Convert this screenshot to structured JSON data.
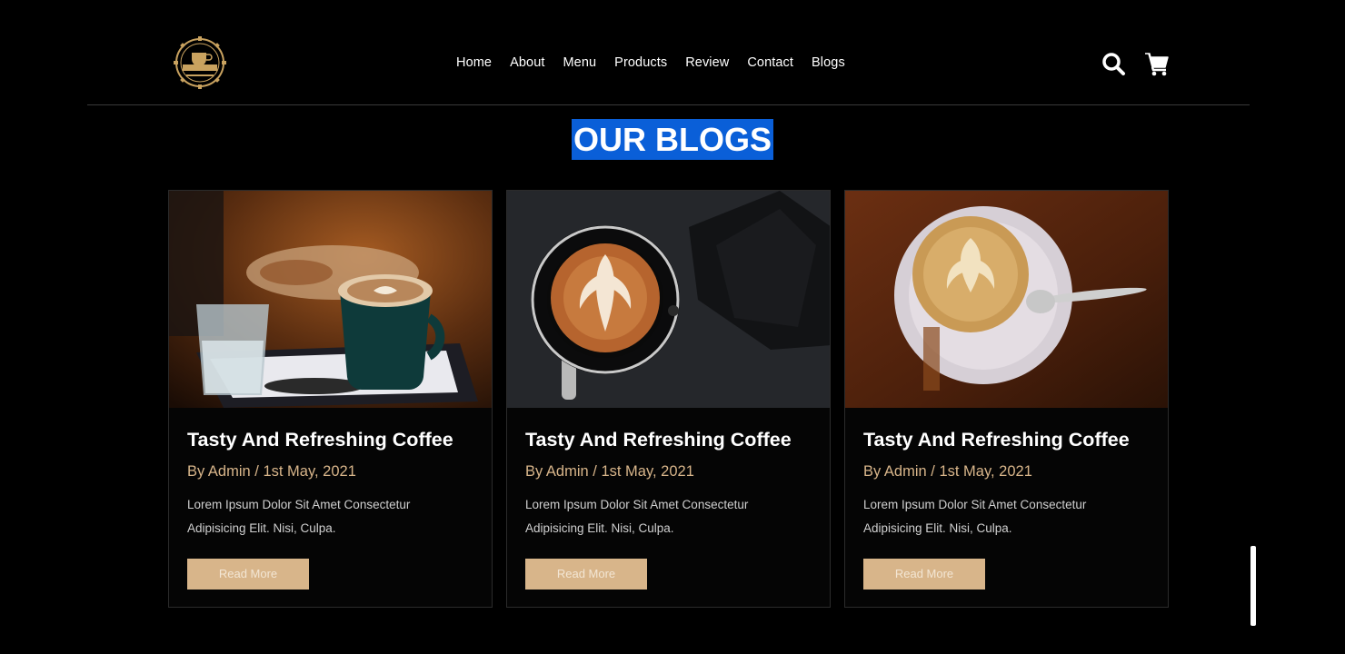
{
  "nav": {
    "items": [
      "Home",
      "About",
      "Menu",
      "Products",
      "Review",
      "Contact",
      "Blogs"
    ]
  },
  "header": {
    "logo_icon": "coffee-logo-icon",
    "search_icon": "search-icon",
    "cart_icon": "shopping-cart-icon"
  },
  "blogs": {
    "heading": "OUR BLOGS",
    "cards": [
      {
        "image": "latte-with-water-glass-image",
        "title": "Tasty And Refreshing Coffee",
        "meta": "By Admin / 1st May, 2021",
        "text": "Lorem Ipsum Dolor Sit Amet Consectetur Adipisicing Elit. Nisi, Culpa.",
        "button": "Read More"
      },
      {
        "image": "latte-art-top-view-image",
        "title": "Tasty And Refreshing Coffee",
        "meta": "By Admin / 1st May, 2021",
        "text": "Lorem Ipsum Dolor Sit Amet Consectetur Adipisicing Elit. Nisi, Culpa.",
        "button": "Read More"
      },
      {
        "image": "cappuccino-saucer-spoon-image",
        "title": "Tasty And Refreshing Coffee",
        "meta": "By Admin / 1st May, 2021",
        "text": "Lorem Ipsum Dolor Sit Amet Consectetur Adipisicing Elit. Nisi, Culpa.",
        "button": "Read More"
      }
    ]
  },
  "colors": {
    "background": "#000000",
    "accent": "#d8b58a",
    "heading_highlight": "#0a5fd8"
  }
}
